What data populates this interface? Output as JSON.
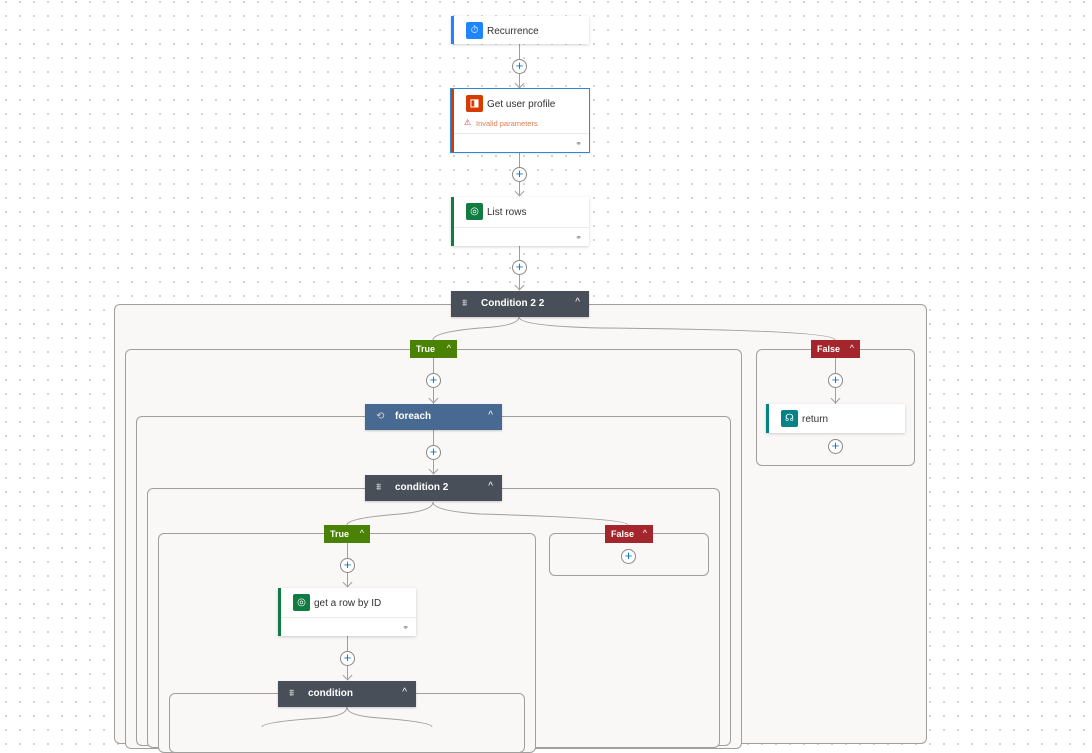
{
  "flow": {
    "recurrence": {
      "title": "Recurrence",
      "icon": "clock-icon",
      "color": "#1f85ff"
    },
    "get_user_profile": {
      "title": "Get user profile",
      "icon": "office-icon",
      "color": "#d83b01",
      "warning": "Invalid parameters",
      "warning_icon": "warning-icon"
    },
    "list_rows": {
      "title": "List rows",
      "icon": "dataverse-icon",
      "color": "#107c41"
    },
    "condition_2_2": {
      "title": "Condition 2 2",
      "icon": "condition-icon",
      "true_label": "True",
      "false_label": "False",
      "false_branch": {
        "return": {
          "title": "return",
          "icon": "respond-icon",
          "color": "#038387"
        }
      }
    },
    "foreach": {
      "title": "foreach",
      "icon": "loop-icon",
      "color": "#486991"
    },
    "condition_2": {
      "title": "condition 2",
      "icon": "condition-icon",
      "true_label": "True",
      "false_label": "False"
    },
    "get_row_by_id": {
      "title": "get a row by ID",
      "icon": "dataverse-icon",
      "color": "#107c41"
    },
    "condition": {
      "title": "condition",
      "icon": "condition-icon"
    }
  },
  "glyphs": {
    "plus": "+",
    "chevron_up": "^",
    "warning": "⚠",
    "link": "⚭"
  }
}
